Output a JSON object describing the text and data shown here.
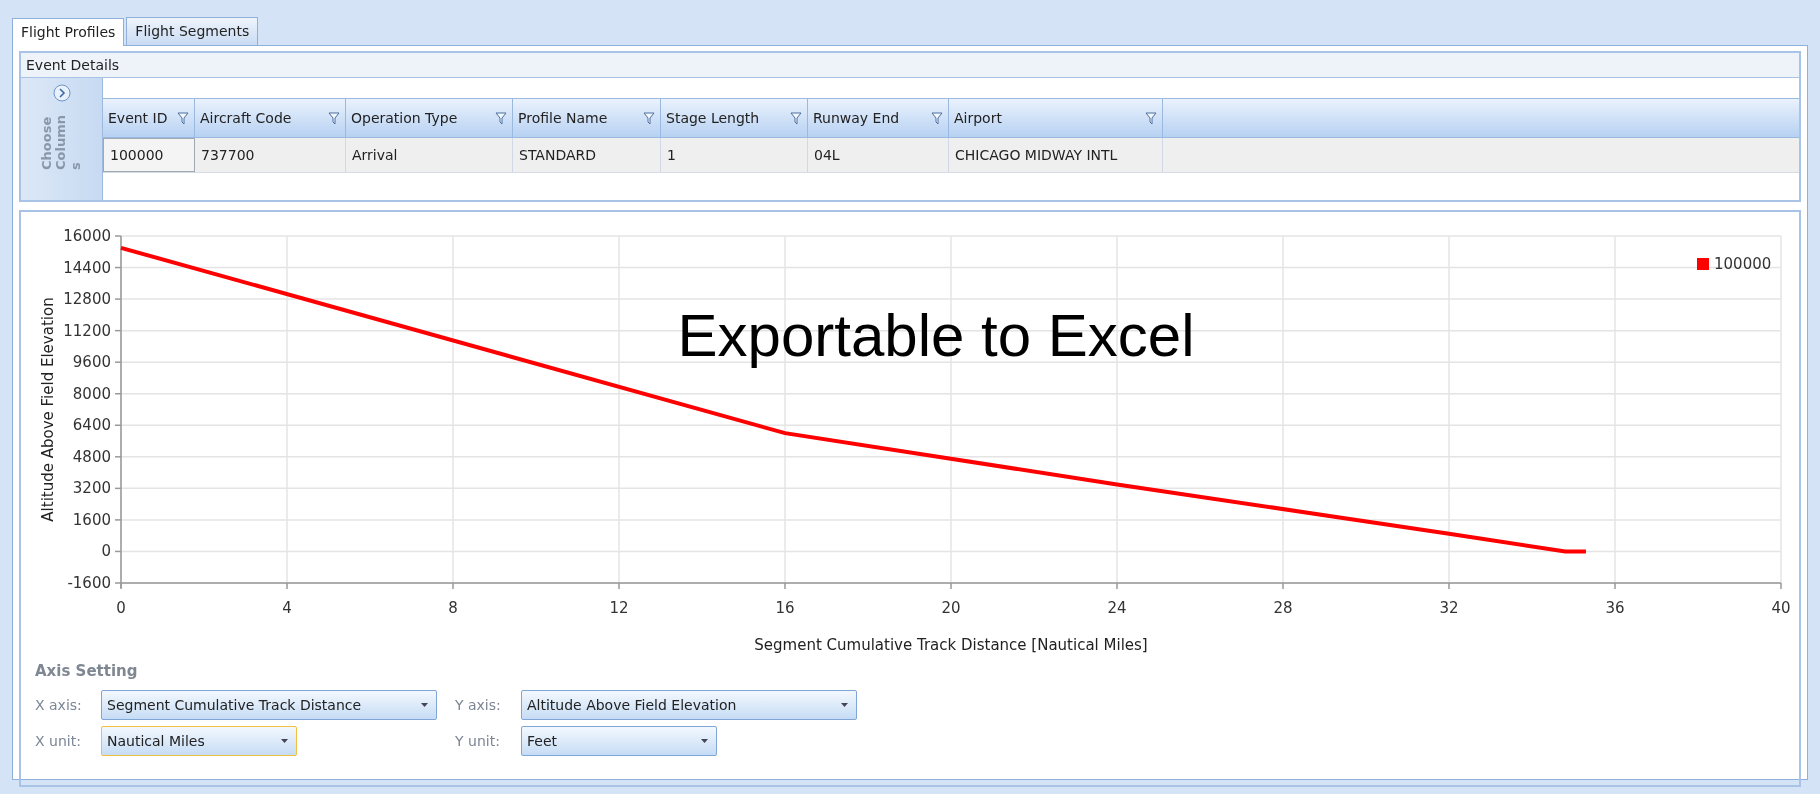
{
  "tabs": [
    {
      "label": "Flight Profiles",
      "selected": true
    },
    {
      "label": "Flight Segments",
      "selected": false
    }
  ],
  "event_details": {
    "title": "Event Details",
    "choose_columns": "Choose Columns",
    "columns": [
      "Event ID",
      "Aircraft Code",
      "Operation Type",
      "Profile Name",
      "Stage Length",
      "Runway End",
      "Airport"
    ],
    "rows": [
      [
        "100000",
        "737700",
        "Arrival",
        "STANDARD",
        "1",
        "04L",
        "CHICAGO MIDWAY INTL"
      ]
    ]
  },
  "chart": {
    "annotation": "Exportable to Excel",
    "chart_data": {
      "type": "line",
      "xlabel": "Segment Cumulative Track Distance [Nautical Miles]",
      "ylabel": "Altitude Above Field Elevation",
      "x": [
        0,
        16,
        24,
        32,
        34.8,
        35.3
      ],
      "series": [
        {
          "name": "100000",
          "color": "#ff0000",
          "values": [
            15400,
            6000,
            3400,
            900,
            0,
            0
          ]
        }
      ],
      "grid": true,
      "xlim": [
        0,
        40
      ],
      "ylim": [
        -1600,
        16000
      ],
      "xticks": [
        0,
        4,
        8,
        12,
        16,
        20,
        24,
        28,
        32,
        36,
        40
      ],
      "yticks": [
        -1600,
        0,
        1600,
        3200,
        4800,
        6400,
        8000,
        9600,
        11200,
        12800,
        14400,
        16000
      ]
    }
  },
  "axis_setting": {
    "title": "Axis Setting",
    "fields": [
      {
        "label": "X axis:",
        "value": "Segment Cumulative Track Distance",
        "focused": false
      },
      {
        "label": "Y axis:",
        "value": "Altitude Above Field Elevation",
        "focused": false
      },
      {
        "label": "X unit:",
        "value": "Nautical Miles",
        "focused": true
      },
      {
        "label": "Y unit:",
        "value": "Feet",
        "focused": false
      }
    ]
  }
}
